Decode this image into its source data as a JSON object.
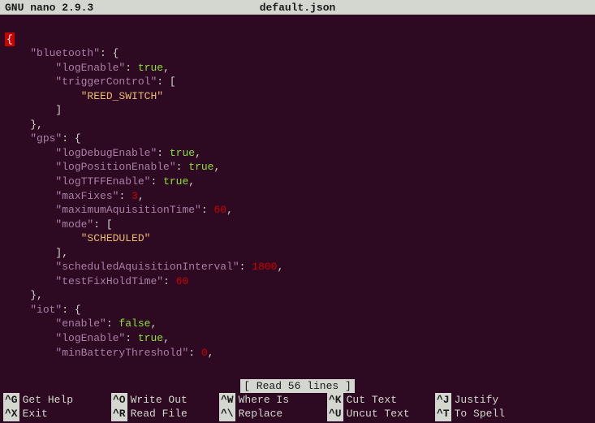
{
  "titlebar": {
    "app": "GNU nano 2.9.3",
    "filename": "default.json"
  },
  "cursor_char": "{",
  "lines": [
    {
      "indent": 4,
      "tokens": [
        {
          "t": "key",
          "v": "\"bluetooth\""
        },
        {
          "t": "punct",
          "v": ": {"
        }
      ]
    },
    {
      "indent": 8,
      "tokens": [
        {
          "t": "key",
          "v": "\"logEnable\""
        },
        {
          "t": "punct",
          "v": ": "
        },
        {
          "t": "bool",
          "v": "true"
        },
        {
          "t": "punct",
          "v": ","
        }
      ]
    },
    {
      "indent": 8,
      "tokens": [
        {
          "t": "key",
          "v": "\"triggerControl\""
        },
        {
          "t": "punct",
          "v": ": ["
        }
      ]
    },
    {
      "indent": 12,
      "tokens": [
        {
          "t": "string",
          "v": "\"REED_SWITCH\""
        }
      ]
    },
    {
      "indent": 8,
      "tokens": [
        {
          "t": "punct",
          "v": "]"
        }
      ]
    },
    {
      "indent": 4,
      "tokens": [
        {
          "t": "punct",
          "v": "},"
        }
      ]
    },
    {
      "indent": 4,
      "tokens": [
        {
          "t": "key",
          "v": "\"gps\""
        },
        {
          "t": "punct",
          "v": ": {"
        }
      ]
    },
    {
      "indent": 8,
      "tokens": [
        {
          "t": "key",
          "v": "\"logDebugEnable\""
        },
        {
          "t": "punct",
          "v": ": "
        },
        {
          "t": "bool",
          "v": "true"
        },
        {
          "t": "punct",
          "v": ","
        }
      ]
    },
    {
      "indent": 8,
      "tokens": [
        {
          "t": "key",
          "v": "\"logPositionEnable\""
        },
        {
          "t": "punct",
          "v": ": "
        },
        {
          "t": "bool",
          "v": "true"
        },
        {
          "t": "punct",
          "v": ","
        }
      ]
    },
    {
      "indent": 8,
      "tokens": [
        {
          "t": "key",
          "v": "\"logTTFFEnable\""
        },
        {
          "t": "punct",
          "v": ": "
        },
        {
          "t": "bool",
          "v": "true"
        },
        {
          "t": "punct",
          "v": ","
        }
      ]
    },
    {
      "indent": 8,
      "tokens": [
        {
          "t": "key",
          "v": "\"maxFixes\""
        },
        {
          "t": "punct",
          "v": ": "
        },
        {
          "t": "number",
          "v": "3"
        },
        {
          "t": "punct",
          "v": ","
        }
      ]
    },
    {
      "indent": 8,
      "tokens": [
        {
          "t": "key",
          "v": "\"maximumAquisitionTime\""
        },
        {
          "t": "punct",
          "v": ": "
        },
        {
          "t": "number",
          "v": "60"
        },
        {
          "t": "punct",
          "v": ","
        }
      ]
    },
    {
      "indent": 8,
      "tokens": [
        {
          "t": "key",
          "v": "\"mode\""
        },
        {
          "t": "punct",
          "v": ": ["
        }
      ]
    },
    {
      "indent": 12,
      "tokens": [
        {
          "t": "string",
          "v": "\"SCHEDULED\""
        }
      ]
    },
    {
      "indent": 8,
      "tokens": [
        {
          "t": "punct",
          "v": "],"
        }
      ]
    },
    {
      "indent": 8,
      "tokens": [
        {
          "t": "key",
          "v": "\"scheduledAquisitionInterval\""
        },
        {
          "t": "punct",
          "v": ": "
        },
        {
          "t": "number",
          "v": "1800"
        },
        {
          "t": "punct",
          "v": ","
        }
      ]
    },
    {
      "indent": 8,
      "tokens": [
        {
          "t": "key",
          "v": "\"testFixHoldTime\""
        },
        {
          "t": "punct",
          "v": ": "
        },
        {
          "t": "number",
          "v": "60"
        }
      ]
    },
    {
      "indent": 4,
      "tokens": [
        {
          "t": "punct",
          "v": "},"
        }
      ]
    },
    {
      "indent": 4,
      "tokens": [
        {
          "t": "key",
          "v": "\"iot\""
        },
        {
          "t": "punct",
          "v": ": {"
        }
      ]
    },
    {
      "indent": 8,
      "tokens": [
        {
          "t": "key",
          "v": "\"enable\""
        },
        {
          "t": "punct",
          "v": ": "
        },
        {
          "t": "bool",
          "v": "false"
        },
        {
          "t": "punct",
          "v": ","
        }
      ]
    },
    {
      "indent": 8,
      "tokens": [
        {
          "t": "key",
          "v": "\"logEnable\""
        },
        {
          "t": "punct",
          "v": ": "
        },
        {
          "t": "bool",
          "v": "true"
        },
        {
          "t": "punct",
          "v": ","
        }
      ]
    },
    {
      "indent": 8,
      "tokens": [
        {
          "t": "key",
          "v": "\"minBatteryThreshold\""
        },
        {
          "t": "punct",
          "v": ": "
        },
        {
          "t": "number",
          "v": "0"
        },
        {
          "t": "punct",
          "v": ","
        }
      ]
    }
  ],
  "status": "[ Read 56 lines ]",
  "shortcuts": {
    "row1": [
      {
        "key": "^G",
        "label": "Get Help"
      },
      {
        "key": "^O",
        "label": "Write Out"
      },
      {
        "key": "^W",
        "label": "Where Is"
      },
      {
        "key": "^K",
        "label": "Cut Text"
      },
      {
        "key": "^J",
        "label": "Justify"
      }
    ],
    "row2": [
      {
        "key": "^X",
        "label": "Exit"
      },
      {
        "key": "^R",
        "label": "Read File"
      },
      {
        "key": "^\\",
        "label": "Replace"
      },
      {
        "key": "^U",
        "label": "Uncut Text"
      },
      {
        "key": "^T",
        "label": "To Spell"
      }
    ]
  }
}
